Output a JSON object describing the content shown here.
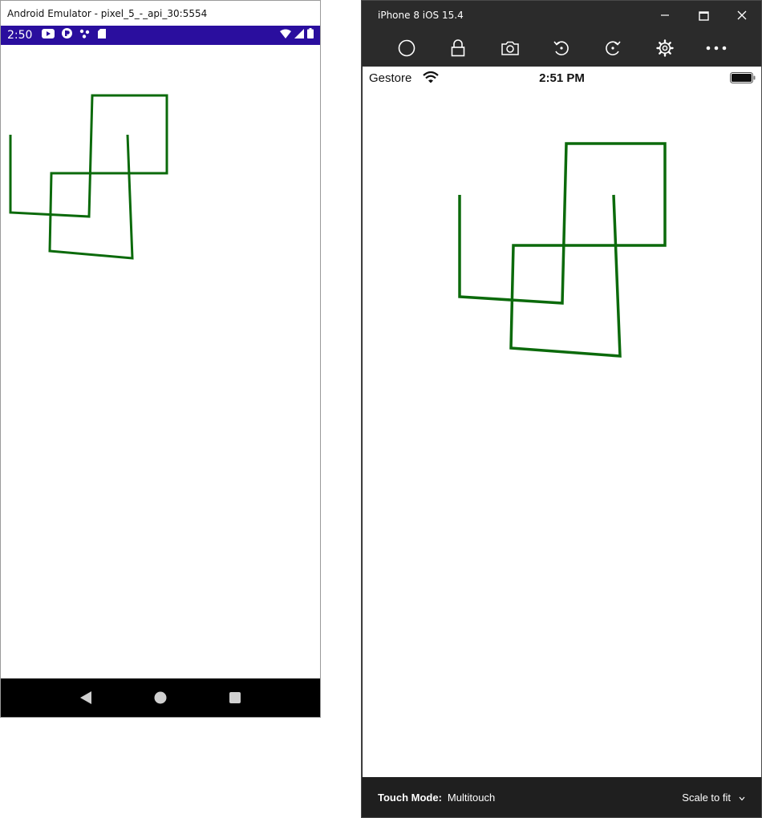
{
  "android": {
    "window_title": "Android Emulator - pixel_5_-_api_30:5554",
    "status_time": "2:50",
    "status_icons": [
      "youtube-icon",
      "play-games-icon",
      "notification-dots-icon",
      "sd-card-icon"
    ],
    "status_right_icons": [
      "wifi-icon",
      "signal-icon",
      "battery-icon"
    ],
    "nav_buttons": [
      "back-icon",
      "home-icon",
      "recents-icon"
    ],
    "drawing_color": "#0b6a0b",
    "statusbar_color": "#2a0e9e"
  },
  "ios": {
    "window_title": "iPhone 8 iOS 15.4",
    "window_controls": [
      "minimize-icon",
      "maximize-icon",
      "close-icon"
    ],
    "toolbar_icons": [
      "home-circle-icon",
      "lock-icon",
      "screenshot-camera-icon",
      "rotate-left-icon",
      "rotate-right-icon",
      "settings-gear-icon",
      "more-icon"
    ],
    "carrier": "Gestore",
    "time": "2:51 PM",
    "touch_mode_label": "Touch Mode:",
    "touch_mode_value": "Multitouch",
    "scale_label": "Scale to fit",
    "drawing_color": "#0b6a0b"
  }
}
